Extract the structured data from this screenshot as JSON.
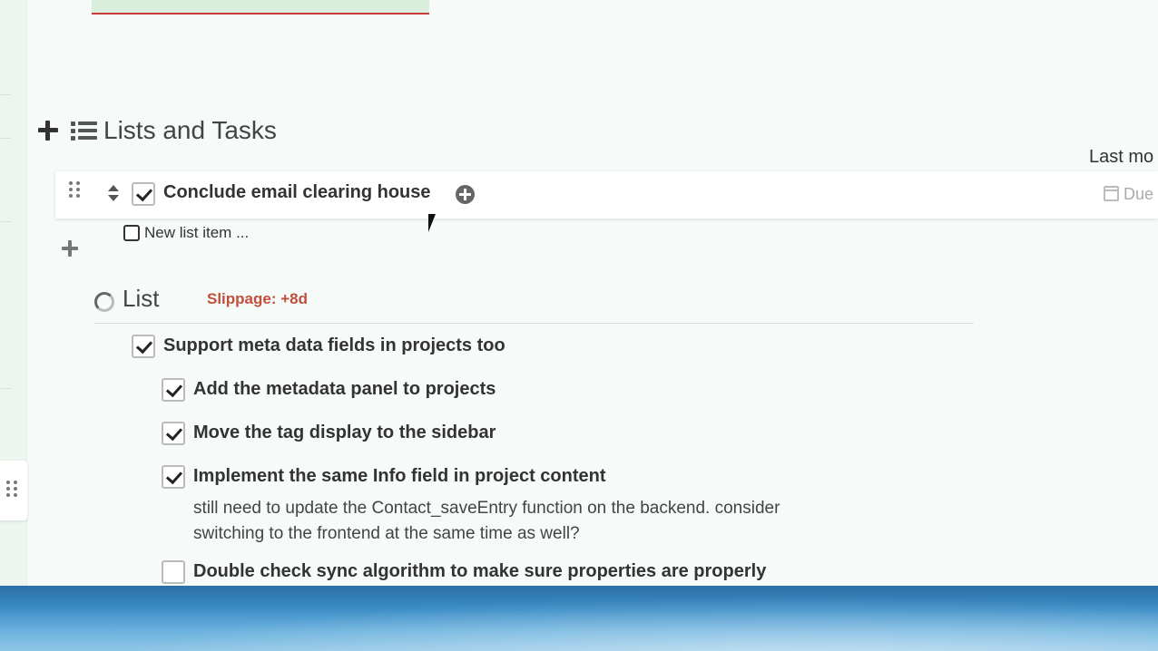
{
  "section": {
    "title": "Lists and Tasks",
    "add_icon": "plus-icon",
    "list_icon": "list-icon"
  },
  "header": {
    "last_modified_label": "Last mo"
  },
  "task": {
    "title": "Conclude email clearing house",
    "checked": true,
    "due_label": "Due",
    "new_list_item_placeholder": "New list item ..."
  },
  "list": {
    "title": "List",
    "slippage": "Slippage: +8d",
    "items": [
      {
        "label": "Support meta data fields in projects too",
        "checked": true,
        "level": 0
      },
      {
        "label": "Add the metadata panel to projects",
        "checked": true,
        "level": 1
      },
      {
        "label": "Move the tag display to the sidebar",
        "checked": true,
        "level": 1
      },
      {
        "label": "Implement the same Info field in project content",
        "checked": true,
        "level": 1
      },
      {
        "label": "Double check sync algorithm to make sure properties are properly",
        "checked": false,
        "level": 1
      }
    ],
    "note": "still need to update the Contact_saveEntry function on the backend. consider switching to the frontend at the same time as well?"
  },
  "colors": {
    "accent_red": "#c9393a",
    "slippage": "#c0503c",
    "background": "#f6faf8"
  }
}
